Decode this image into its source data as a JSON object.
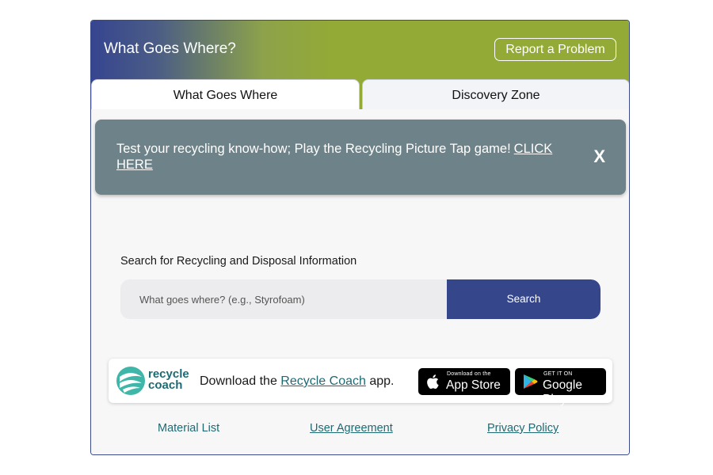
{
  "header": {
    "title": "What Goes Where?",
    "report_button": "Report a Problem"
  },
  "tabs": [
    {
      "label": "What Goes Where",
      "active": true
    },
    {
      "label": "Discovery Zone",
      "active": false
    }
  ],
  "banner": {
    "text": "Test your recycling know-how; Play the Recycling Picture Tap game!",
    "link": "CLICK HERE",
    "close": "X"
  },
  "search": {
    "label": "Search for Recycling and Disposal Information",
    "placeholder": "What goes where? (e.g., Styrofoam)",
    "value": "",
    "button": "Search"
  },
  "recycle_coach": {
    "logo_line1": "recycle",
    "logo_line2": "coach",
    "text_before": "Download the",
    "link": "Recycle Coach",
    "text_after": "app.",
    "app_store_small": "Download on the",
    "app_store_big": "App Store",
    "google_small": "GET IT ON",
    "google_big": "Google Play"
  },
  "footer": {
    "material_list": "Material List",
    "user_agreement": "User Agreement",
    "privacy_policy": "Privacy Policy"
  },
  "colors": {
    "header_left": "#36458f",
    "header_right": "#93aa36",
    "banner": "#6e8389",
    "search_button": "#35468b",
    "link": "#1e6a73"
  }
}
